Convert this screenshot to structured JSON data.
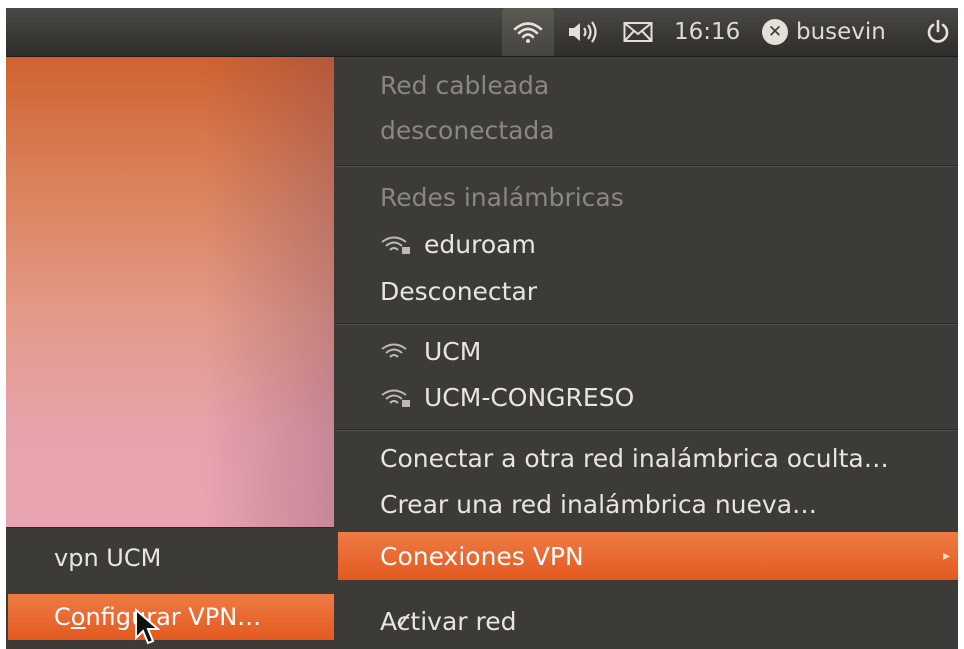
{
  "panel": {
    "clock": "16:16",
    "user": "busevin",
    "icons": [
      "wifi-icon",
      "volume-icon",
      "mail-icon",
      "user-status-icon",
      "power-icon"
    ]
  },
  "network_menu": {
    "wired_header": "Red cableada",
    "wired_status": "desconectada",
    "wireless_header": "Redes inalámbricas",
    "connected_network": "eduroam",
    "disconnect": "Desconectar",
    "networks": [
      "UCM",
      "UCM-CONGRESO"
    ],
    "hidden_network": "Conectar a otra red inalámbrica oculta…",
    "new_network": "Crear una red inalámbrica nueva…",
    "vpn_connections": "Conexiones VPN",
    "enable_network": "Activar red"
  },
  "vpn_submenu": {
    "connection": "vpn UCM",
    "configure_pre": "C",
    "configure_u": "o",
    "configure_post": "nfigurar VPN…"
  },
  "colors": {
    "panel": "#3a3935",
    "menu_bg": "#3c3b37",
    "highlight": "#e8622a",
    "text": "#e8e5de",
    "text_disabled": "#8a877f"
  }
}
